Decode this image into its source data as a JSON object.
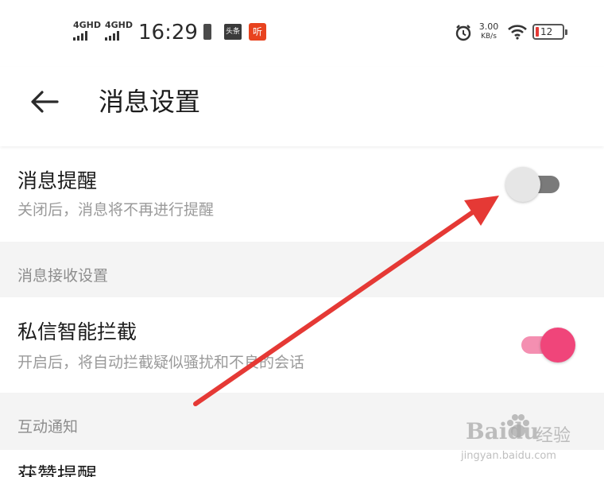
{
  "status_bar": {
    "network_1": "4GHD",
    "network_2": "4GHD",
    "time": "16:29",
    "app_badge_1": "头条",
    "app_badge_2": "听",
    "speed_value": "3.00",
    "speed_unit": "KB/s",
    "battery_level": "12"
  },
  "header": {
    "title": "消息设置",
    "back_icon": "arrow-left-icon"
  },
  "settings": {
    "message_reminder": {
      "title": "消息提醒",
      "description": "关闭后，消息将不再进行提醒",
      "enabled": false
    },
    "section_receive": {
      "label": "消息接收设置"
    },
    "smart_block": {
      "title": "私信智能拦截",
      "description": "开启后，将自动拦截疑似骚扰和不良的会话",
      "enabled": true
    },
    "section_interaction": {
      "label": "互动通知"
    },
    "partial_row": {
      "title": "获赞提醒"
    }
  },
  "colors": {
    "toggle_on_track": "#f48fb1",
    "toggle_on_knob": "#f0457a",
    "toggle_off_track": "#7a7a7a",
    "toggle_off_knob": "#e4e4e4",
    "annotation_arrow": "#e53935"
  },
  "watermark": {
    "logo": "Baidu",
    "label": "经验",
    "url": "jingyan.baidu.com"
  }
}
